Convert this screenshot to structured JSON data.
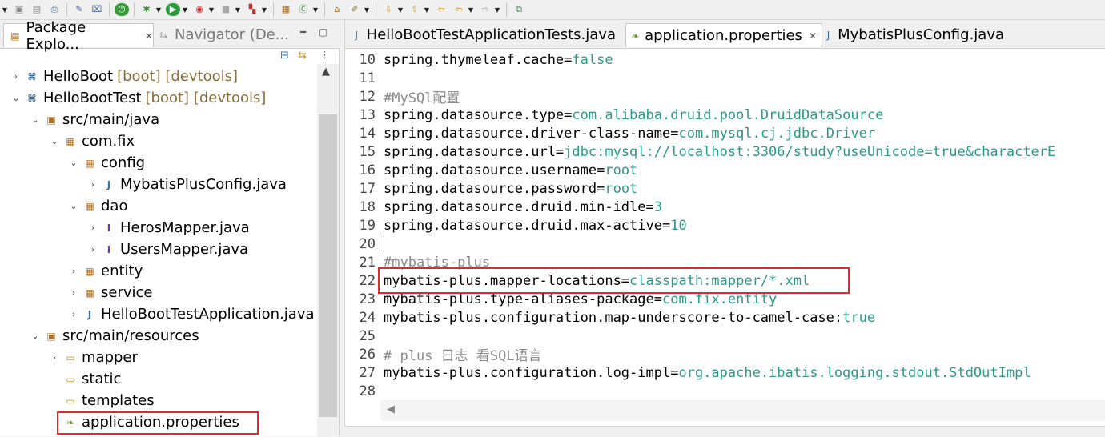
{
  "left_panel": {
    "tab_package_explorer": "Package Explo...",
    "tab_navigator": "Navigator (De...",
    "tree": [
      {
        "label": "HelloBoot",
        "deco": "[boot] [devtools]"
      },
      {
        "label": "HelloBootTest",
        "deco": "[boot] [devtools]"
      },
      {
        "label": "src/main/java"
      },
      {
        "label": "com.fix"
      },
      {
        "label": "config"
      },
      {
        "label": "MybatisPlusConfig.java"
      },
      {
        "label": "dao"
      },
      {
        "label": "HerosMapper.java"
      },
      {
        "label": "UsersMapper.java"
      },
      {
        "label": "entity"
      },
      {
        "label": "service"
      },
      {
        "label": "HelloBootTestApplication.java"
      },
      {
        "label": "src/main/resources"
      },
      {
        "label": "mapper"
      },
      {
        "label": "static"
      },
      {
        "label": "templates"
      },
      {
        "label": "application.properties"
      }
    ]
  },
  "editor": {
    "tabs": [
      {
        "label": "HelloBootTestApplicationTests.java"
      },
      {
        "label": "application.properties"
      },
      {
        "label": "MybatisPlusConfig.java"
      }
    ],
    "lines": [
      {
        "n": "10",
        "key": "spring.thymeleaf.cache=",
        "val": "false"
      },
      {
        "n": "11"
      },
      {
        "n": "12",
        "comment": "#MySQl配置"
      },
      {
        "n": "13",
        "key": "spring.datasource.type=",
        "val": "com.alibaba.druid.pool.DruidDataSource"
      },
      {
        "n": "14",
        "key": "spring.datasource.driver-class-name=",
        "val": "com.mysql.cj.jdbc.Driver"
      },
      {
        "n": "15",
        "key": "spring.datasource.url=",
        "val": "jdbc:mysql://localhost:3306/study?useUnicode=true&characterE"
      },
      {
        "n": "16",
        "key": "spring.datasource.username=",
        "val": "root"
      },
      {
        "n": "17",
        "key": "spring.datasource.password=",
        "val": "root"
      },
      {
        "n": "18",
        "key": "spring.datasource.druid.min-idle=",
        "val": "3"
      },
      {
        "n": "19",
        "key": "spring.datasource.druid.max-active=",
        "val": "10"
      },
      {
        "n": "20"
      },
      {
        "n": "21",
        "comment": "#mybatis-plus"
      },
      {
        "n": "22",
        "key": "mybatis-plus.mapper-locations=",
        "val": "classpath:mapper/*.xml"
      },
      {
        "n": "23",
        "key": "mybatis-plus.type-aliases-package=",
        "val": "com.fix.entity"
      },
      {
        "n": "24",
        "key": "mybatis-plus.configuration.map-underscore-to-camel-case: ",
        "val": "true"
      },
      {
        "n": "25"
      },
      {
        "n": "26",
        "comment": "# plus 日志 看SQL语言"
      },
      {
        "n": "27",
        "key": "mybatis-plus.configuration.log-impl=",
        "val": "org.apache.ibatis.logging.stdout.StdOutImpl"
      },
      {
        "n": "28"
      }
    ]
  },
  "colors": {
    "highlight": "#e02a2a",
    "value": "#2a9a8a",
    "comment": "#8a8a8a"
  }
}
